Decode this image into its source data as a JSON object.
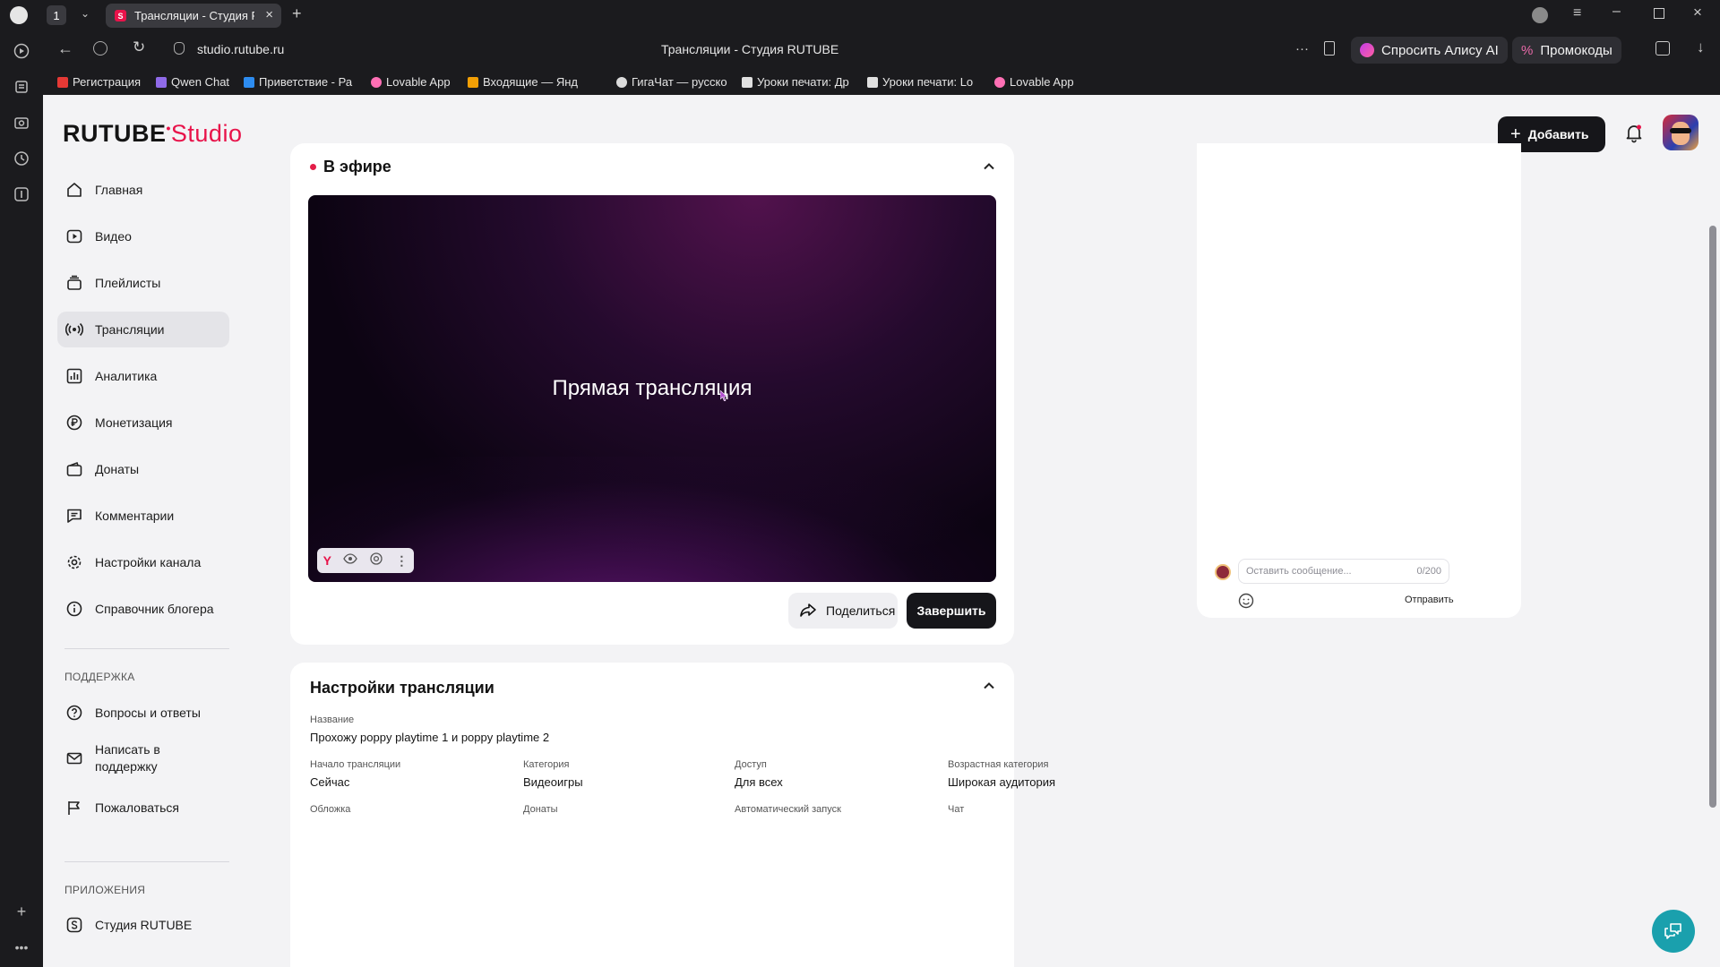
{
  "browser": {
    "tab_count": "1",
    "tab_title": "Трансляции - Студия RUTUBE",
    "url": "studio.rutube.ru",
    "window_title": "Трансляции - Студия RUTUBE",
    "ask_alice": "Спросить Алису AI",
    "promo": "Промокоды",
    "bookmarks": [
      "Регистрация",
      "Qwen Chat",
      "Приветствие - Ра",
      "Lovable App",
      "Входящие — Янд",
      "ГигаЧат — русско",
      "Уроки печати: Др",
      "Уроки печати: Lo",
      "Lovable App"
    ]
  },
  "brand": {
    "name": "RUTUBE",
    "studio": "Studio",
    "accent": "#e8134a"
  },
  "header": {
    "add_label": "Добавить"
  },
  "sidebar": {
    "items": [
      {
        "label": "Главная",
        "icon": "home-icon"
      },
      {
        "label": "Видео",
        "icon": "video-icon"
      },
      {
        "label": "Плейлисты",
        "icon": "playlist-icon"
      },
      {
        "label": "Трансляции",
        "icon": "broadcast-icon"
      },
      {
        "label": "Аналитика",
        "icon": "analytics-icon"
      },
      {
        "label": "Монетизация",
        "icon": "ruble-icon"
      },
      {
        "label": "Донаты",
        "icon": "wallet-icon"
      },
      {
        "label": "Комментарии",
        "icon": "comment-icon"
      },
      {
        "label": "Настройки канала",
        "icon": "gear-icon"
      },
      {
        "label": "Справочник блогера",
        "icon": "info-icon"
      }
    ],
    "support_head": "ПОДДЕРЖКА",
    "support": [
      {
        "label": "Вопросы и ответы",
        "icon": "question-icon"
      },
      {
        "label": "Написать в поддержку",
        "icon": "mail-icon"
      },
      {
        "label": "Пожаловаться",
        "icon": "flag-icon"
      }
    ],
    "apps_head": "ПРИЛОЖЕНИЯ",
    "apps": [
      {
        "label": "Студия RUTUBE",
        "icon": "studio-app-icon"
      }
    ]
  },
  "live": {
    "title": "В эфире",
    "video_text": "Прямая трансляция",
    "share_label": "Поделиться",
    "end_label": "Завершить"
  },
  "settings": {
    "title": "Настройки трансляции",
    "name_label": "Название",
    "name_value": "Прохожу poppy playtime 1 и poppy playtime 2",
    "fields": [
      {
        "label": "Начало трансляции",
        "value": "Сейчас"
      },
      {
        "label": "Категория",
        "value": "Видеоигры"
      },
      {
        "label": "Доступ",
        "value": "Для всех"
      },
      {
        "label": "Возрастная категория",
        "value": "Широкая аудитория"
      }
    ],
    "next_labels": [
      "Обложка",
      "Донаты",
      "Автоматический запуск",
      "Чат"
    ]
  },
  "chat": {
    "placeholder": "Оставить сообщение...",
    "counter": "0/200",
    "send_label": "Отправить"
  }
}
